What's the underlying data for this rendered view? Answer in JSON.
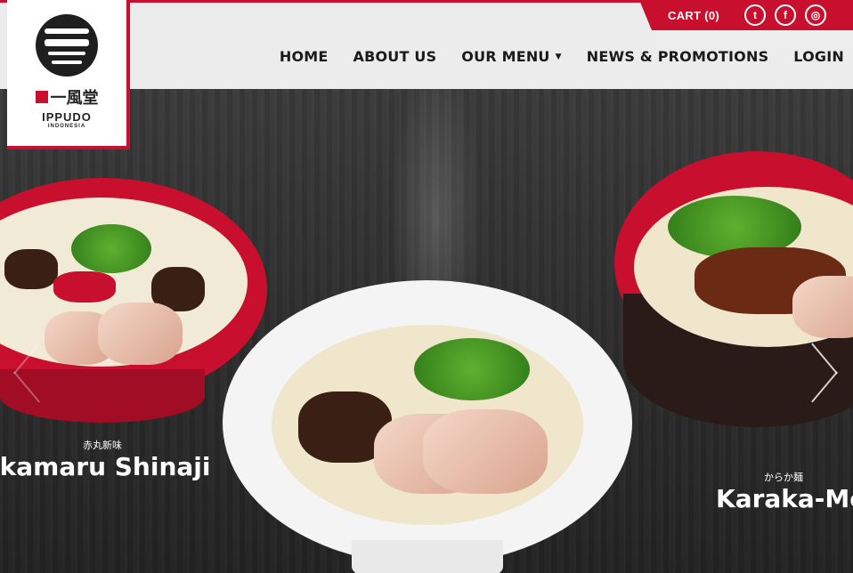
{
  "header": {
    "cart_label": "CART (0)",
    "social_icons": [
      "twitter-icon",
      "facebook-icon",
      "instagram-icon"
    ],
    "nav": [
      {
        "label": "HOME"
      },
      {
        "label": "ABOUT US"
      },
      {
        "label": "OUR MENU"
      },
      {
        "label": "NEWS & PROMOTIONS"
      },
      {
        "label": "LOGIN"
      }
    ]
  },
  "logo": {
    "kanji": "一風堂",
    "name": "IPPUDO",
    "sub": "INDONESIA"
  },
  "slider": {
    "items": [
      {
        "jp": "赤丸新味",
        "name": "Akamaru Shinaji"
      },
      {
        "jp": "からか麺",
        "name": "Karaka-Men"
      }
    ]
  },
  "colors": {
    "accent": "#c8102e"
  }
}
